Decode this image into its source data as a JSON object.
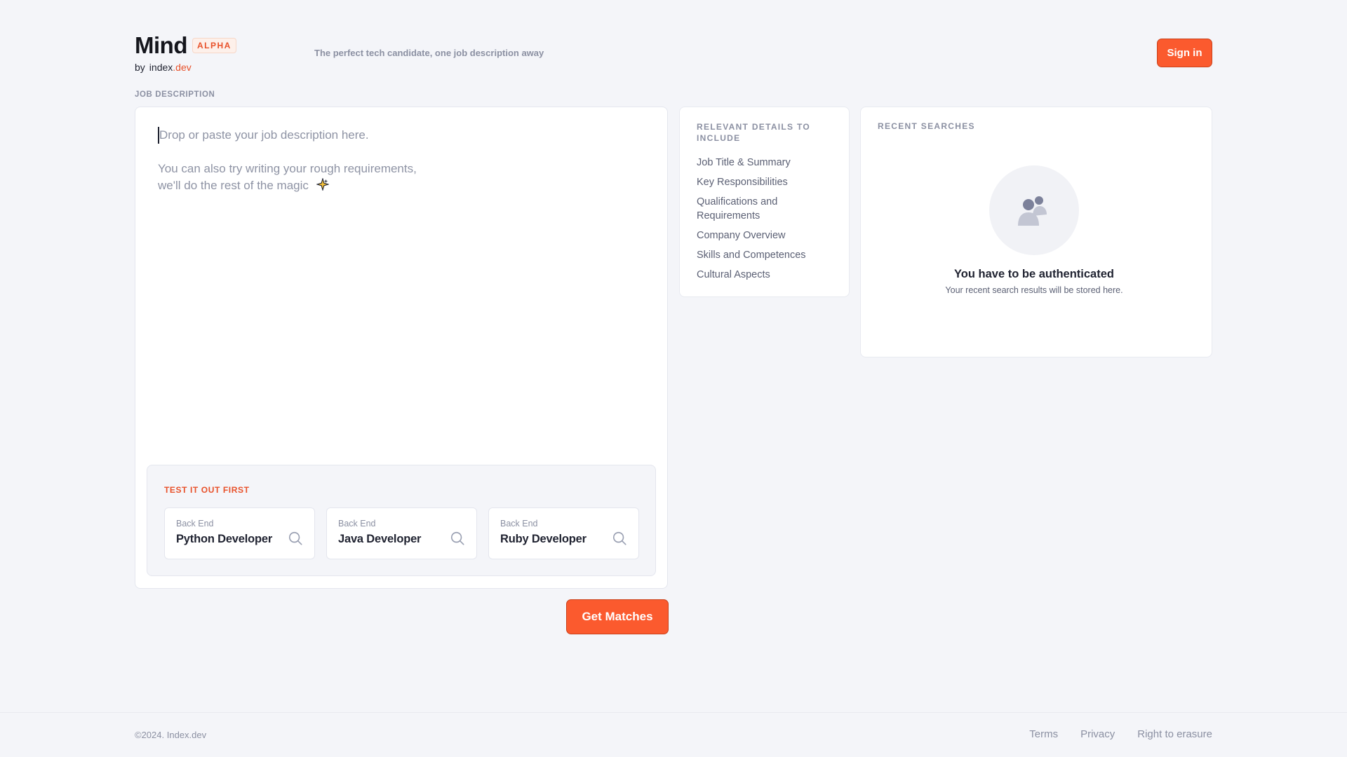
{
  "header": {
    "app_name": "Mind",
    "badge": "ALPHA",
    "by": "by",
    "brand_index": "index",
    "brand_dev": ".dev",
    "tagline": "The perfect tech candidate, one job description away",
    "signin_label": "Sign in"
  },
  "job_description": {
    "label": "JOB DESCRIPTION",
    "placeholder_line1": "Drop or paste your job description here.",
    "placeholder_line2a": "You can also try writing your rough requirements,",
    "placeholder_line2b": "we'll do the rest of the magic",
    "test_label": "TEST IT OUT FIRST",
    "samples": [
      {
        "category": "Back End",
        "role": "Python Developer"
      },
      {
        "category": "Back End",
        "role": "Java Developer"
      },
      {
        "category": "Back End",
        "role": "Ruby Developer"
      }
    ],
    "submit_label": "Get Matches"
  },
  "details": {
    "title": "RELEVANT DETAILS TO INCLUDE",
    "items": [
      "Job Title & Summary",
      "Key Responsibilities",
      "Qualifications and Requirements",
      "Company Overview",
      "Skills and Competences",
      "Cultural Aspects"
    ]
  },
  "recent": {
    "title": "RECENT SEARCHES",
    "auth_title": "You have to be authenticated",
    "auth_subtitle": "Your recent search results will be stored here."
  },
  "footer": {
    "copyright": "©2024. Index.dev",
    "links": [
      "Terms",
      "Privacy",
      "Right to erasure"
    ]
  },
  "colors": {
    "accent": "#fb5a2e",
    "background": "#f4f5f9",
    "muted_text": "#8b90a2"
  },
  "icons": [
    "sparkle-icon",
    "search-icon",
    "users-icon"
  ]
}
